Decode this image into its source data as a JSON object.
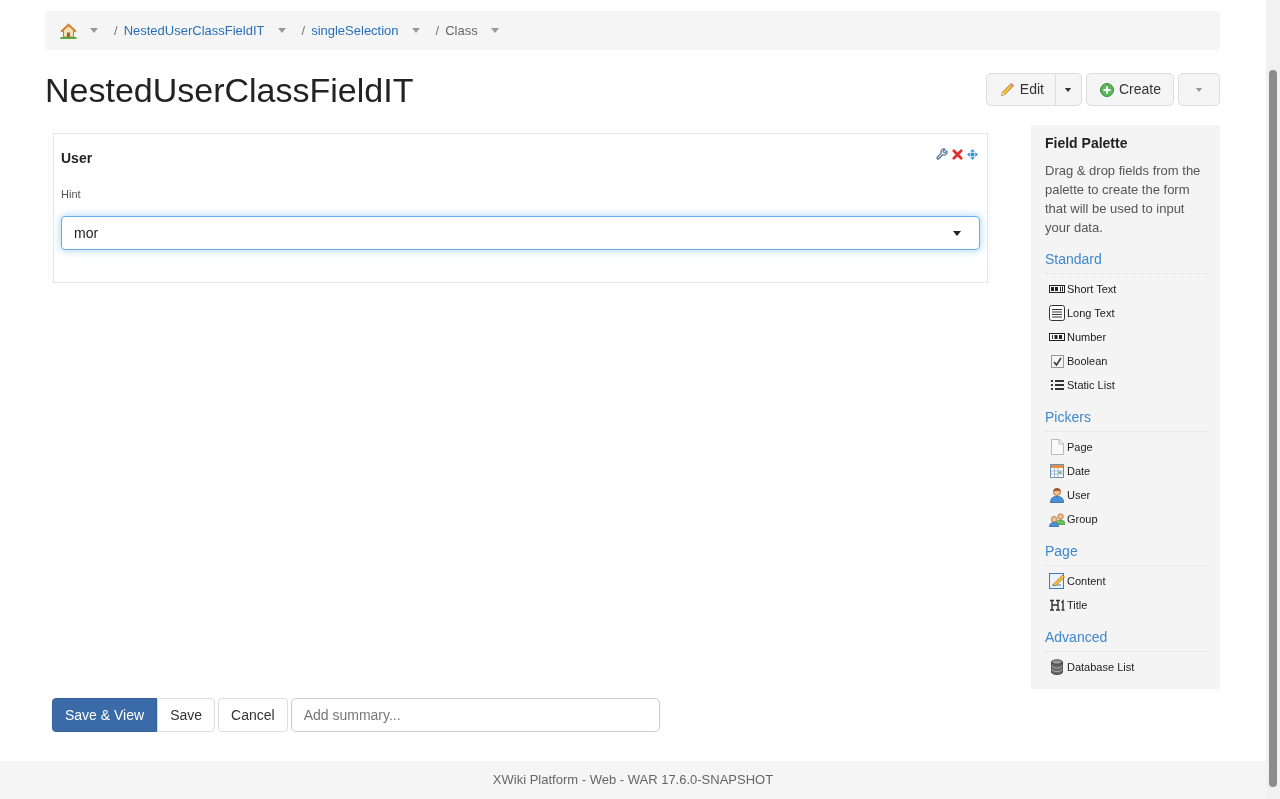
{
  "breadcrumb": [
    {
      "kind": "home"
    },
    {
      "kind": "link",
      "separator": "/",
      "label": "NestedUserClassFieldIT"
    },
    {
      "kind": "link",
      "separator": "/",
      "label": "singleSelection"
    },
    {
      "kind": "current",
      "separator": "/",
      "label": "Class"
    }
  ],
  "title": "NestedUserClassFieldIT",
  "page_actions": [
    {
      "kind": "edit",
      "label": "Edit"
    },
    {
      "kind": "create",
      "label": "Create"
    },
    {
      "kind": "more"
    }
  ],
  "form": {
    "fields": [
      {
        "label": "User",
        "hint": "Hint",
        "value": "mor",
        "focused": true
      }
    ]
  },
  "palette": {
    "title": "Field Palette",
    "description": "Drag & drop fields from the palette to create the form that will be used to input your data.",
    "sections": [
      {
        "title": "Standard",
        "items": [
          {
            "kind": "short-text",
            "label": "Short Text"
          },
          {
            "kind": "long-text",
            "label": "Long Text"
          },
          {
            "kind": "number",
            "label": "Number"
          },
          {
            "kind": "boolean",
            "label": "Boolean"
          },
          {
            "kind": "static-list",
            "label": "Static List"
          }
        ]
      },
      {
        "title": "Pickers",
        "items": [
          {
            "kind": "page",
            "label": "Page"
          },
          {
            "kind": "date",
            "label": "Date"
          },
          {
            "kind": "user",
            "label": "User"
          },
          {
            "kind": "group",
            "label": "Group"
          }
        ]
      },
      {
        "title": "Page",
        "items": [
          {
            "kind": "content",
            "label": "Content"
          },
          {
            "kind": "title",
            "label": "Title"
          }
        ]
      },
      {
        "title": "Advanced",
        "items": [
          {
            "kind": "database-list",
            "label": "Database List"
          }
        ]
      }
    ]
  },
  "editor_actions": [
    {
      "buttons": [
        {
          "kind": "primary",
          "label": "Save & View"
        },
        {
          "kind": "default",
          "label": "Save"
        }
      ]
    },
    {
      "buttons": [
        {
          "kind": "default",
          "label": "Cancel"
        }
      ]
    }
  ],
  "summary": {
    "placeholder": "Add summary..."
  },
  "footer": "XWiki Platform - Web - WAR 17.6.0-SNAPSHOT"
}
